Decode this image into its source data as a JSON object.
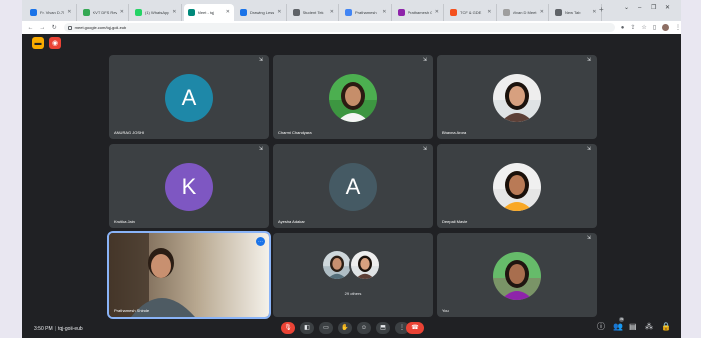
{
  "browser": {
    "tabs": [
      {
        "label": "Fr. Vivan D.756",
        "favicon_color": "#1a73e8",
        "active": false
      },
      {
        "label": "KVT DFS Rev",
        "favicon_color": "#34a853",
        "active": false
      },
      {
        "label": "(1) WhatsApp",
        "favicon_color": "#25d366",
        "active": false
      },
      {
        "label": "Meet - tqj",
        "favicon_color": "#00897b",
        "active": true
      },
      {
        "label": "Drawing Lesson",
        "favicon_color": "#1a73e8",
        "active": false
      },
      {
        "label": "Student Tek",
        "favicon_color": "#5f6368",
        "active": false
      },
      {
        "label": "Prathamesh",
        "favicon_color": "#4285f4",
        "active": false
      },
      {
        "label": "Prathamesh Ge",
        "favicon_color": "#8e24aa",
        "active": false
      },
      {
        "label": "TCF & GDE",
        "favicon_color": "#f4511e",
        "active": false
      },
      {
        "label": "Vivan D Meet",
        "favicon_color": "#9e9e9e",
        "active": false
      },
      {
        "label": "New Tab",
        "favicon_color": "#5f6368",
        "active": false
      }
    ],
    "url": "meet.google.com/tqj-goii-eub"
  },
  "participants": [
    {
      "name": "ANURAG JOSHI",
      "type": "letter",
      "letter": "A",
      "color": "#1e88a8"
    },
    {
      "name": "Charmi Chandyara",
      "type": "photo",
      "photo": "woman-green"
    },
    {
      "name": "Bhavna Arora",
      "type": "photo",
      "photo": "woman-light"
    },
    {
      "name": "Krutika Jain",
      "type": "letter",
      "letter": "K",
      "color": "#7e57c2"
    },
    {
      "name": "Ayesha Adakar",
      "type": "letter",
      "letter": "A",
      "color": "#455a64"
    },
    {
      "name": "Deepali Mavle",
      "type": "photo",
      "photo": "woman-yellow"
    },
    {
      "name": "Prathamesh Shinde",
      "type": "video",
      "speaking": true
    },
    {
      "name": "",
      "type": "others",
      "others_label": "29 others"
    },
    {
      "name": "You",
      "type": "photo",
      "photo": "woman-outdoor"
    }
  ],
  "meeting": {
    "time": "3:50 PM",
    "code": "tqj-goii-eub",
    "participant_count": "39"
  },
  "colors": {
    "background": "#202124",
    "tile": "#3c4043",
    "end_call": "#ea4335",
    "accent": "#8ab4f8"
  }
}
